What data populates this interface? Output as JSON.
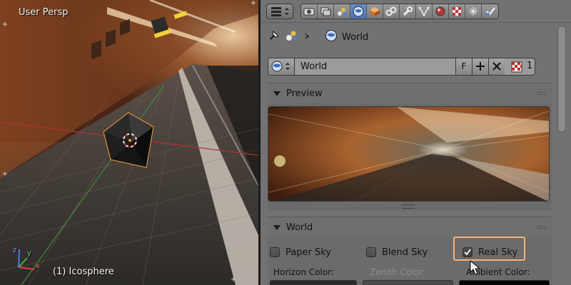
{
  "viewport": {
    "view_name": "User Persp",
    "object_info": "(1) Icosphere",
    "axes": [
      "x",
      "y",
      "z"
    ]
  },
  "properties": {
    "header": {
      "editor_type_icon": "properties-editor-icon",
      "tabs": [
        {
          "icon": "render-icon",
          "active": false
        },
        {
          "icon": "render-layers-icon",
          "active": false
        },
        {
          "icon": "scene-icon",
          "active": false
        },
        {
          "icon": "world-icon",
          "active": true
        },
        {
          "icon": "object-icon",
          "active": false
        },
        {
          "icon": "constraints-icon",
          "active": false
        },
        {
          "icon": "modifiers-icon",
          "active": false
        },
        {
          "icon": "data-icon",
          "active": false
        },
        {
          "icon": "material-icon",
          "active": false
        },
        {
          "icon": "texture-icon",
          "active": false
        },
        {
          "icon": "particles-icon",
          "active": false
        },
        {
          "icon": "physics-icon",
          "active": false
        }
      ]
    },
    "breadcrumb": {
      "item": "World"
    },
    "world_block": {
      "name": "World",
      "fake_user": "F",
      "add": "+",
      "remove": "✕",
      "users": "1"
    },
    "preview_panel": {
      "title": "Preview"
    },
    "world_panel": {
      "title": "World",
      "paper_sky": {
        "label": "Paper Sky",
        "checked": false
      },
      "blend_sky": {
        "label": "Blend Sky",
        "checked": false
      },
      "real_sky": {
        "label": "Real Sky",
        "checked": true
      },
      "horizon_color_label": "Horizon Color:",
      "zenith_color_label": "Zenith Color:",
      "ambient_color_label": "Ambient Color:"
    },
    "colors": {
      "horizon": "#2b2b2b",
      "zenith": "#4a4a4a",
      "ambient": "#050505",
      "active_tab": "#5b80bd",
      "highlight": "#f3b47a"
    }
  }
}
